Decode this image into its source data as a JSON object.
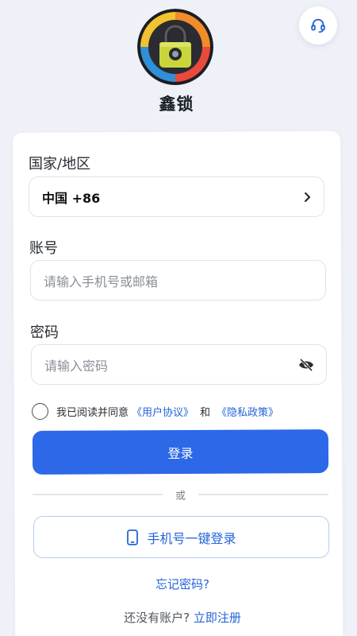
{
  "header": {
    "app_name": "鑫锁",
    "logo_icon": "padlock-logo-icon",
    "support_icon": "headset-icon"
  },
  "form": {
    "region": {
      "label": "国家/地区",
      "value": "中国 +86",
      "icon": "chevron-right-icon"
    },
    "account": {
      "label": "账号",
      "placeholder": "请输入手机号或邮箱",
      "value": ""
    },
    "password": {
      "label": "密码",
      "placeholder": "请输入密码",
      "value": "",
      "toggle_icon": "eye-off-icon"
    },
    "agreement": {
      "checked": false,
      "prefix": "我已阅读并同意",
      "user_agreement": "《用户协议》",
      "conjunction": "和",
      "privacy_policy": "《隐私政策》"
    },
    "login_button": "登录",
    "divider_text": "或",
    "phone_login_button": "手机号一键登录",
    "phone_icon": "smartphone-icon",
    "forgot_password": "忘记密码?",
    "register_prompt": "还没有账户?",
    "register_link": "立即注册"
  },
  "colors": {
    "accent": "#2c68e8",
    "link": "#2463d8",
    "background": "#eef1f7"
  }
}
